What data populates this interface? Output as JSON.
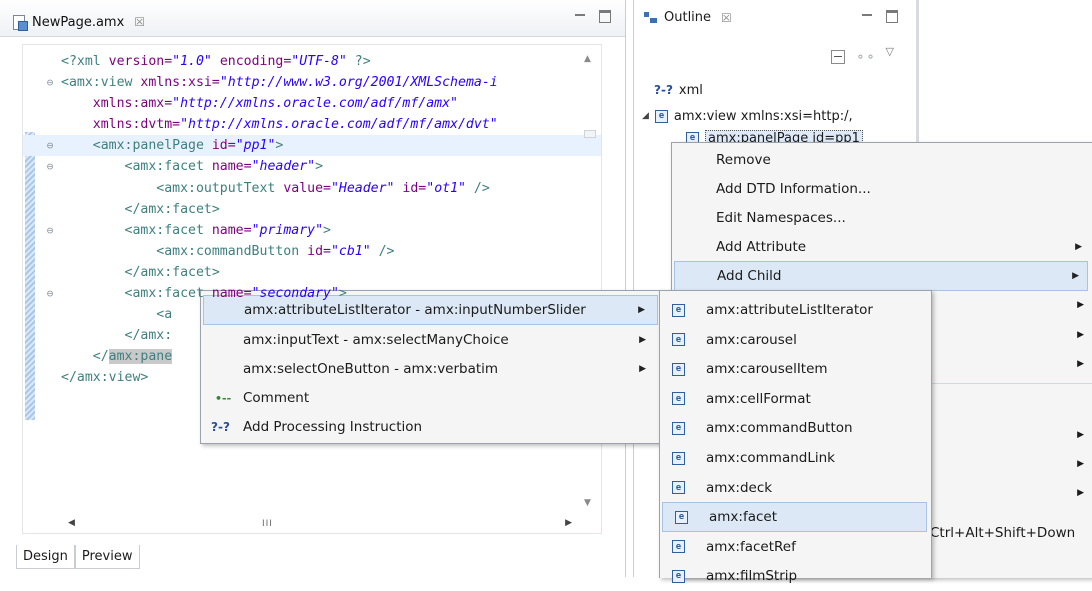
{
  "editor": {
    "tab_title": "NewPage.amx",
    "tab_close": "☒",
    "bottom_tabs": [
      "Design",
      "Preview"
    ],
    "hscroll_grip": "III"
  },
  "code_lines": [
    {
      "fold": "",
      "parts": [
        [
          "tag",
          "<?xml "
        ],
        [
          "attr",
          "version="
        ],
        [
          "str",
          "\"1.0\""
        ],
        [
          "attr",
          " encoding="
        ],
        [
          "str",
          "\"UTF-8\""
        ],
        [
          "tag",
          " ?>"
        ]
      ]
    },
    {
      "fold": "⊖",
      "parts": [
        [
          "tag",
          "<amx:view "
        ],
        [
          "attr",
          "xmlns:xsi="
        ],
        [
          "str",
          "\"http://www.w3.org/2001/XMLSchema-i"
        ]
      ]
    },
    {
      "fold": "",
      "parts": [
        [
          "attr",
          "    xmlns:amx="
        ],
        [
          "str",
          "\"http://xmlns.oracle.com/adf/mf/amx\""
        ]
      ]
    },
    {
      "fold": "",
      "parts": [
        [
          "attr",
          "    xmlns:dvtm="
        ],
        [
          "str",
          "\"http://xmlns.oracle.com/adf/mf/amx/dvt\""
        ]
      ]
    },
    {
      "fold": "⊖",
      "hl": true,
      "parts": [
        [
          "tag",
          "    <amx:panelPage "
        ],
        [
          "attr",
          "id="
        ],
        [
          "str",
          "\"pp1\""
        ],
        [
          "tag",
          ">"
        ]
      ]
    },
    {
      "fold": "⊖",
      "parts": [
        [
          "tag",
          "        <amx:facet "
        ],
        [
          "attr",
          "name="
        ],
        [
          "str",
          "\"header\""
        ],
        [
          "tag",
          ">"
        ]
      ]
    },
    {
      "fold": "",
      "parts": [
        [
          "tag",
          "            <amx:outputText "
        ],
        [
          "attr",
          "value="
        ],
        [
          "str",
          "\"Header\""
        ],
        [
          "attr",
          " id="
        ],
        [
          "str",
          "\"ot1\""
        ],
        [
          "tag",
          " />"
        ]
      ]
    },
    {
      "fold": "",
      "parts": [
        [
          "tag",
          "        </amx:facet>"
        ]
      ]
    },
    {
      "fold": "⊖",
      "parts": [
        [
          "tag",
          "        <amx:facet "
        ],
        [
          "attr",
          "name="
        ],
        [
          "str",
          "\"primary\""
        ],
        [
          "tag",
          ">"
        ]
      ]
    },
    {
      "fold": "",
      "parts": [
        [
          "tag",
          "            <amx:commandButton "
        ],
        [
          "attr",
          "id="
        ],
        [
          "str",
          "\"cb1\""
        ],
        [
          "tag",
          " />"
        ]
      ]
    },
    {
      "fold": "",
      "parts": [
        [
          "tag",
          "        </amx:facet>"
        ]
      ]
    },
    {
      "fold": "⊖",
      "parts": [
        [
          "tag",
          "        <amx:facet "
        ],
        [
          "attr",
          "name="
        ],
        [
          "str",
          "\"secondary\""
        ],
        [
          "tag",
          ">"
        ]
      ]
    },
    {
      "fold": "",
      "parts": [
        [
          "tag",
          "            <a"
        ]
      ]
    },
    {
      "fold": "",
      "parts": [
        [
          "tag",
          "        </amx:"
        ]
      ]
    },
    {
      "fold": "",
      "parts": [
        [
          "tag",
          "    </"
        ],
        [
          "sel",
          "amx:pane"
        ]
      ]
    },
    {
      "fold": "",
      "parts": [
        [
          "tag",
          "</amx:view>"
        ]
      ]
    }
  ],
  "outline": {
    "tab_title": "Outline",
    "tab_close": "☒",
    "view_menu": "▽",
    "tree": [
      {
        "icon": "?-?",
        "label": "xml"
      },
      {
        "icon": "e",
        "label": "amx:view xmlns:xsi=http:/,"
      },
      {
        "icon": "e",
        "label": "amx:panelPage id=pp1"
      }
    ]
  },
  "menu_main": {
    "items": [
      {
        "label": "Remove",
        "submenu": false
      },
      {
        "label": "Add DTD Information...",
        "submenu": false
      },
      {
        "label": "Edit Namespaces...",
        "submenu": false
      },
      {
        "label": "Add Attribute",
        "submenu": true
      },
      {
        "label": "Add Child",
        "submenu": true,
        "active": true
      }
    ],
    "shortcut": "Ctrl+Alt+Shift+Down"
  },
  "menu_groups": [
    {
      "label": "amx:attributeListIterator - amx:inputNumberSlider",
      "submenu": true,
      "icon": "",
      "active": true
    },
    {
      "label": "amx:inputText - amx:selectManyChoice",
      "submenu": true,
      "icon": ""
    },
    {
      "label": "amx:selectOneButton - amx:verbatim",
      "submenu": true,
      "icon": ""
    },
    {
      "label": "Comment",
      "submenu": false,
      "icon": "comment-icon"
    },
    {
      "label": "Add Processing Instruction",
      "submenu": false,
      "icon": "?-?"
    }
  ],
  "menu_elements": [
    "amx:attributeListIterator",
    "amx:carousel",
    "amx:carouselItem",
    "amx:cellFormat",
    "amx:commandButton",
    "amx:commandLink",
    "amx:deck",
    "amx:facet",
    "amx:facetRef",
    "amx:filmStrip"
  ],
  "menu_elements_active": "amx:facet",
  "element_icon_letter": "e",
  "submenu_arrow": "▶"
}
